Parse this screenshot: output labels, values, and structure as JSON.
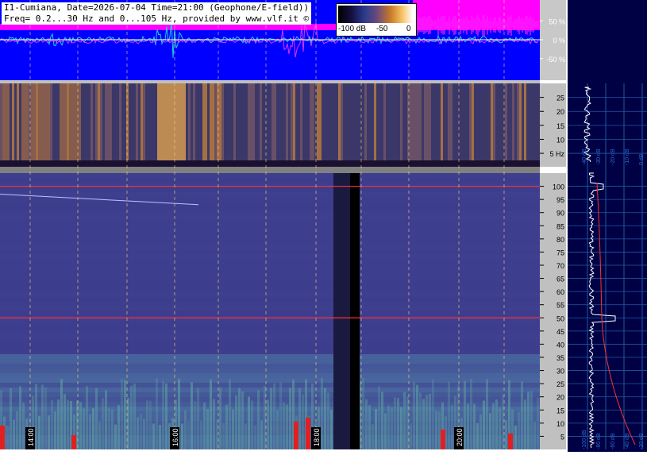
{
  "header": {
    "line1": "I1-Cumiana, Date=2026-07-04 Time=21:00 (Geophone/E-field))",
    "line2": "Freq= 0.2...30 Hz and 0...105 Hz, provided by www.vlf.it ©"
  },
  "colorbar": {
    "labels": [
      "-100 dB",
      "-50",
      "0"
    ]
  },
  "chart_data": [
    {
      "type": "line",
      "name": "waveform",
      "ylabel": "",
      "yticks": [
        {
          "value": 50,
          "label": "50 %"
        },
        {
          "value": 0,
          "label": "0 %"
        },
        {
          "value": -50,
          "label": "-50 %"
        }
      ],
      "ylim": [
        -100,
        100
      ]
    },
    {
      "type": "heatmap",
      "name": "spectrogram_low",
      "yticks": [
        {
          "value": 25,
          "label": "25"
        },
        {
          "value": 20,
          "label": "20"
        },
        {
          "value": 15,
          "label": "15"
        },
        {
          "value": 10,
          "label": "10"
        },
        {
          "value": 5,
          "label": "5 Hz"
        }
      ],
      "ylim": [
        0.2,
        30
      ]
    },
    {
      "type": "heatmap",
      "name": "spectrogram_high",
      "yticks": [
        100,
        95,
        90,
        85,
        80,
        75,
        70,
        65,
        60,
        55,
        50,
        45,
        40,
        35,
        30,
        25,
        20,
        15,
        10,
        5
      ],
      "ylim": [
        0,
        105
      ],
      "xticks": [
        "14:00",
        "16:00",
        "18:00",
        "20:00"
      ],
      "lines_hz": [
        50,
        100
      ]
    },
    {
      "type": "line",
      "name": "spectrum_profile",
      "xticks": [
        "-100 dB",
        "-80 dB",
        "-60 dB",
        "-40 dB",
        "-20 dB"
      ],
      "low_band_xticks": [
        "-40 dB",
        "-30 dB",
        "-20 dB",
        "-10 dB",
        "0 dB"
      ]
    }
  ]
}
